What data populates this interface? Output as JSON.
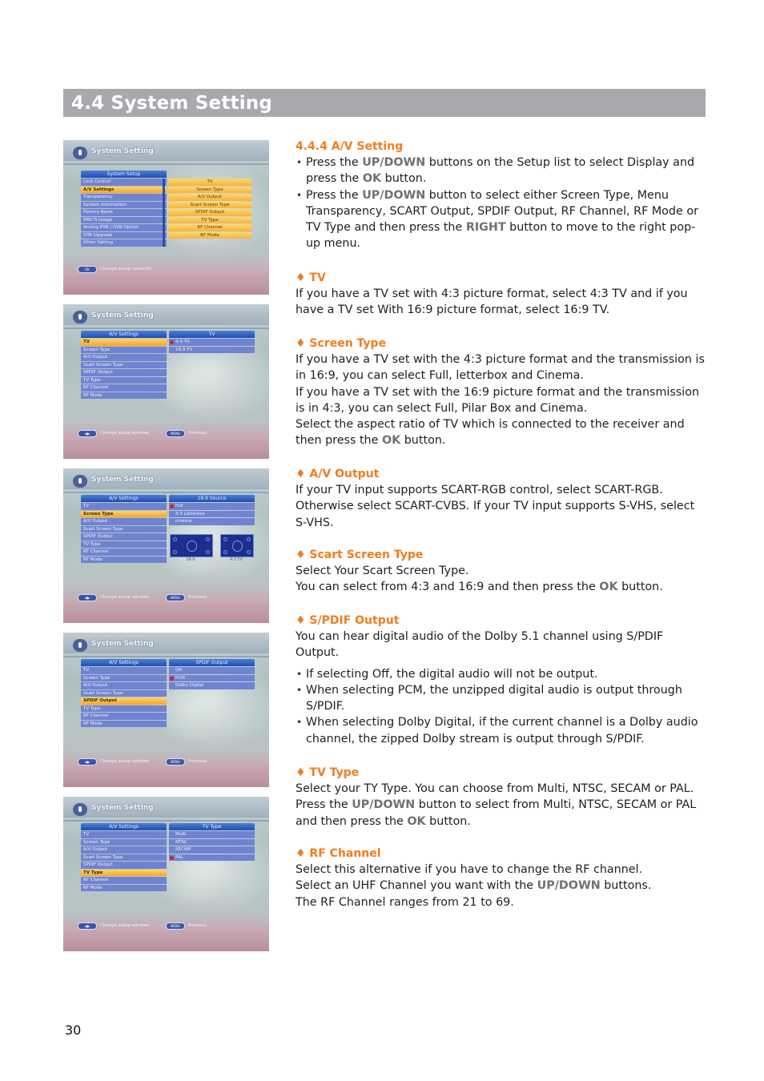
{
  "section": {
    "title": "4.4  System Setting"
  },
  "screenshots": [
    {
      "title": "System Setting",
      "left_panel": {
        "header": "System Setup",
        "rows": [
          "Lock Control",
          "A/V Settings",
          "Transparency",
          "System Information",
          "Factory Reset",
          "RMC'S Usage",
          "Analog PVR / DVB Option",
          "OTA Upgrade",
          "Other Setting"
        ],
        "selected_index": 1
      },
      "option_list": [
        "TV",
        "Screen Type",
        "A/V Output",
        "Scart Screen Type",
        "SPDIF Output",
        "TV Type",
        "RF Channel",
        "RF Mode"
      ],
      "footer": [
        {
          "key": "OK",
          "label": "Change setup contents"
        }
      ]
    },
    {
      "title": "System Setting",
      "left_panel": {
        "header": "A/V Settings",
        "rows": [
          "TV",
          "Screen Type",
          "A/V Output",
          "Scart Screen Type",
          "SPDIF Output",
          "TV Type",
          "RF Channel",
          "RF Mode"
        ],
        "selected_index": 0
      },
      "right_panel": {
        "header": "TV",
        "rows": [
          "4:3 TV",
          "16:9 TV"
        ],
        "checked_index": 0
      },
      "footer": [
        {
          "key": "◀▶",
          "label": "Change setup window"
        },
        {
          "key": "MENU",
          "label": "Previous"
        }
      ]
    },
    {
      "title": "System Setting",
      "left_panel": {
        "header": "A/V Settings",
        "rows": [
          "TV",
          "Screen Type",
          "A/V Output",
          "Scart Screen Type",
          "SPDIF Output",
          "TV Type",
          "RF Channel",
          "RF Mode"
        ],
        "selected_index": 1
      },
      "right_panel": {
        "header": "16:9 Source",
        "rows": [
          "Full",
          "4:3 Letterbox",
          "cinema"
        ],
        "checked_index": 0
      },
      "previews": [
        "16:9",
        "4:3 TV"
      ],
      "footer": [
        {
          "key": "◀▶",
          "label": "Change setup window"
        },
        {
          "key": "MENU",
          "label": "Previous"
        }
      ]
    },
    {
      "title": "System Setting",
      "left_panel": {
        "header": "A/V Settings",
        "rows": [
          "TV",
          "Screen Type",
          "A/V Output",
          "Scart Screen Type",
          "SPDIF Output",
          "TV Type",
          "RF Channel",
          "RF Mode"
        ],
        "selected_index": 4
      },
      "right_panel": {
        "header": "SPDIF Output",
        "rows": [
          "Off",
          "PCM",
          "Dolby Digital"
        ],
        "checked_index": 1
      },
      "footer": [
        {
          "key": "◀▶",
          "label": "Change setup window"
        },
        {
          "key": "MENU",
          "label": "Previous"
        }
      ]
    },
    {
      "title": "System Setting",
      "left_panel": {
        "header": "A/V Settings",
        "rows": [
          "TV",
          "Screen Type",
          "A/V Output",
          "Scart Screen Type",
          "SPDIF Output",
          "TV Type",
          "RF Channel",
          "RF Mode"
        ],
        "selected_index": 5
      },
      "right_panel": {
        "header": "TV Type",
        "rows": [
          "Multi",
          "NTSC",
          "SECAM",
          "PAL"
        ],
        "checked_index": 3
      },
      "footer": [
        {
          "key": "◀▶",
          "label": "Change setup window"
        },
        {
          "key": "MENU",
          "label": "Previous"
        }
      ]
    }
  ],
  "content": {
    "subsection_title": "4.4.4  A/V Setting",
    "intro_bullets": [
      {
        "parts": [
          {
            "t": "Press the "
          },
          {
            "t": "UP/DOWN",
            "kw": true
          },
          {
            "t": " buttons on the Setup list to select Display and press the "
          },
          {
            "t": "OK",
            "kw": true
          },
          {
            "t": " button."
          }
        ]
      },
      {
        "parts": [
          {
            "t": "Press the "
          },
          {
            "t": "UP/DOWN",
            "kw": true
          },
          {
            "t": " button to select either Screen Type, Menu Transparency, SCART Output, SPDIF Output, RF Channel, RF Mode or TV Type and then press the "
          },
          {
            "t": "RIGHT",
            "kw": true
          },
          {
            "t": " button to move to the right pop-up menu."
          }
        ]
      }
    ],
    "tv": {
      "heading": "♦  TV",
      "text": "If you have a TV set with 4:3 picture format, select 4:3 TV and if you have a TV set With 16:9 picture format, select 16:9 TV."
    },
    "screen_type": {
      "heading": "♦  Screen Type",
      "lines": [
        "If you have a TV set with the 4:3 picture format and the transmission is in 16:9, you can select Full, letterbox and Cinema.",
        "If you have a TV set with the 16:9 picture format and the transmission is in 4:3, you can select Full, Pilar Box and Cinema."
      ],
      "last": [
        {
          "t": "Select the aspect ratio of TV which is connected to the receiver and then press the "
        },
        {
          "t": "OK",
          "kw": true
        },
        {
          "t": " button."
        }
      ]
    },
    "av_output": {
      "heading": "♦  A/V Output",
      "text": "If your TV input supports SCART-RGB control, select SCART-RGB. Otherwise select SCART-CVBS. If your TV input supports S-VHS, select S-VHS."
    },
    "scart_screen_type": {
      "heading": "♦ Scart Screen Type",
      "line1": "Select Your Scart Screen Type.",
      "line2": [
        {
          "t": "You can select from 4:3 and 16:9 and then press the "
        },
        {
          "t": "OK",
          "kw": true
        },
        {
          "t": " button."
        }
      ]
    },
    "spdif_output": {
      "heading": "♦  S/PDIF Output",
      "text": "You can hear digital audio of the Dolby 5.1 channel using S/PDIF Output.",
      "bullets": [
        "If selecting Off, the digital audio will not be output.",
        "When selecting PCM, the unzipped digital audio is output through S/PDIF.",
        "When selecting Dolby Digital, if the current channel is a Dolby audio channel, the zipped Dolby stream is output through S/PDIF."
      ]
    },
    "tv_type": {
      "heading": "♦  TV Type",
      "parts": [
        {
          "t": "Select your TY Type. You can choose from Multi, NTSC, SECAM or PAL. Press the "
        },
        {
          "t": "UP/DOWN",
          "kw": true
        },
        {
          "t": " button to select from Multi, NTSC, SECAM or PAL and then press the "
        },
        {
          "t": "OK",
          "kw": true
        },
        {
          "t": " button."
        }
      ]
    },
    "rf_channel": {
      "heading": "♦  RF Channel",
      "line1": "Select this alternative if you have to change the RF channel.",
      "line2": [
        {
          "t": "Select an UHF Channel you want with the "
        },
        {
          "t": "UP/DOWN",
          "kw": true
        },
        {
          "t": " buttons."
        }
      ],
      "line3": "The RF Channel ranges from 21 to 69."
    }
  },
  "page_number": "30",
  "colors": {
    "heading_orange": "#f07d1e",
    "section_bar_gray": "#a8a9ad",
    "keyword_gray": "#707070",
    "osd_selected": "#f4a72c",
    "osd_row_blue": "#7083d1"
  }
}
